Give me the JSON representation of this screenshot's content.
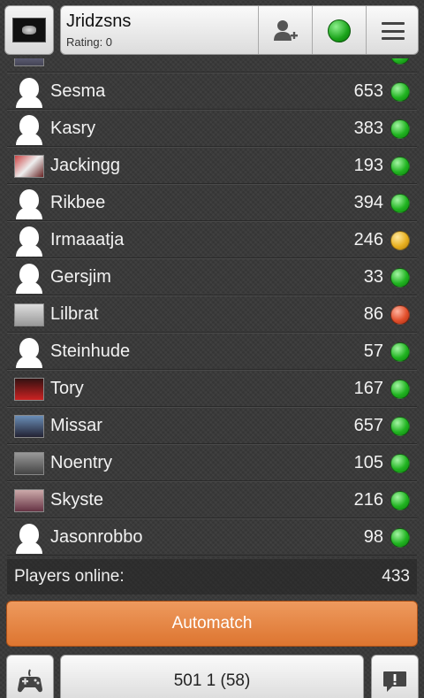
{
  "header": {
    "username": "Jridzsns",
    "rating_label": "Rating: 0",
    "icons": {
      "add_friend": "add-user-icon",
      "status": "status-green-icon",
      "menu": "menu-icon"
    }
  },
  "players": [
    {
      "name": "Sesma",
      "rating": "653",
      "status": "green",
      "avatar": "default"
    },
    {
      "name": "Kasry",
      "rating": "383",
      "status": "green",
      "avatar": "default"
    },
    {
      "name": "Jackingg",
      "rating": "193",
      "status": "green",
      "avatar": "photo"
    },
    {
      "name": "Rikbee",
      "rating": "394",
      "status": "green",
      "avatar": "default"
    },
    {
      "name": "Irmaaatja",
      "rating": "246",
      "status": "yellow",
      "avatar": "default"
    },
    {
      "name": "Gersjim",
      "rating": "33",
      "status": "green",
      "avatar": "default"
    },
    {
      "name": "Lilbrat",
      "rating": "86",
      "status": "red",
      "avatar": "photo"
    },
    {
      "name": "Steinhude",
      "rating": "57",
      "status": "green",
      "avatar": "default"
    },
    {
      "name": "Tory",
      "rating": "167",
      "status": "green",
      "avatar": "photo"
    },
    {
      "name": "Missar",
      "rating": "657",
      "status": "green",
      "avatar": "photo"
    },
    {
      "name": "Noentry",
      "rating": "105",
      "status": "green",
      "avatar": "photo"
    },
    {
      "name": "Skyste",
      "rating": "216",
      "status": "green",
      "avatar": "photo"
    },
    {
      "name": "Jasonrobbo",
      "rating": "98",
      "status": "green",
      "avatar": "default"
    }
  ],
  "online": {
    "label": "Players online:",
    "count": "433"
  },
  "automatch_label": "Automatch",
  "bottom": {
    "game_mode": "501 1 (58)",
    "left_icon": "gamepad-icon",
    "right_icon": "feedback-icon"
  },
  "colors": {
    "green": "#21b421",
    "yellow": "#e8b020",
    "red": "#e2502c",
    "accent": "#dd7530"
  }
}
